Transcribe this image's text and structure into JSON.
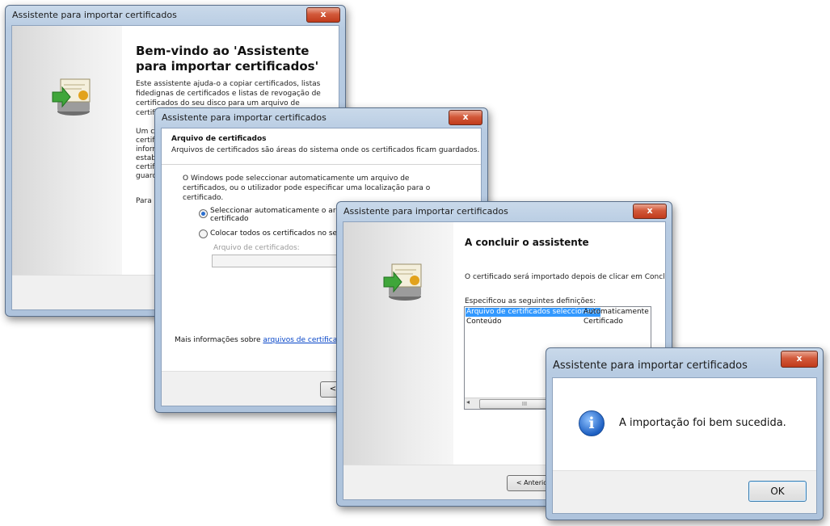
{
  "window1": {
    "title": "Assistente para importar certificados",
    "close": "x",
    "heading": "Bem-vindo ao 'Assistente para importar certificados'",
    "intro": "Este assistente ajuda-o a copiar certificados, listas fidedignas de certificados e listas de revogação de certificados do seu disco para um arquivo de certificados.",
    "partial_lines": [
      "Um cer",
      "certific",
      "inform",
      "estabe",
      "certific",
      "guarda"
    ],
    "partial_continue": "Para c"
  },
  "window2": {
    "title": "Assistente para importar certificados",
    "close": "x",
    "section_title": "Arquivo de certificados",
    "section_desc": "Arquivos de certificados são áreas do sistema onde os certificados ficam guardados.",
    "body": "O Windows pode seleccionar automaticamente um arquivo de certificados, ou o utilizador pode especificar uma localização para o certificado.",
    "radio_auto": "Seleccionar automaticamente o arquivo de c",
    "radio_auto_line2": "certificado",
    "radio_manual": "Colocar todos os certificados no seguinte ar",
    "store_label": "Arquivo de certificados:",
    "more_info_prefix": "Mais informações sobre",
    "more_info_link": "arquivos de certificados",
    "back_button": "<"
  },
  "window3": {
    "title": "Assistente para importar certificados",
    "close": "x",
    "heading": "A concluir o assistente",
    "desc": "O certificado será importado depois de clicar em Concluir.",
    "settings_label": "Especificou as seguintes definições:",
    "settings": [
      {
        "name": "Arquivo de certificados seleccionado",
        "value": "Automaticamente s"
      },
      {
        "name": "Conteúdo",
        "value": "Certificado"
      }
    ],
    "scroll_left": "◂",
    "scroll_thumb": "III",
    "back_button": "< Anterio"
  },
  "dialog": {
    "title": "Assistente para importar certificados",
    "close": "x",
    "message": "A importação foi bem sucedida.",
    "info_icon": "i",
    "ok_button": "OK"
  }
}
